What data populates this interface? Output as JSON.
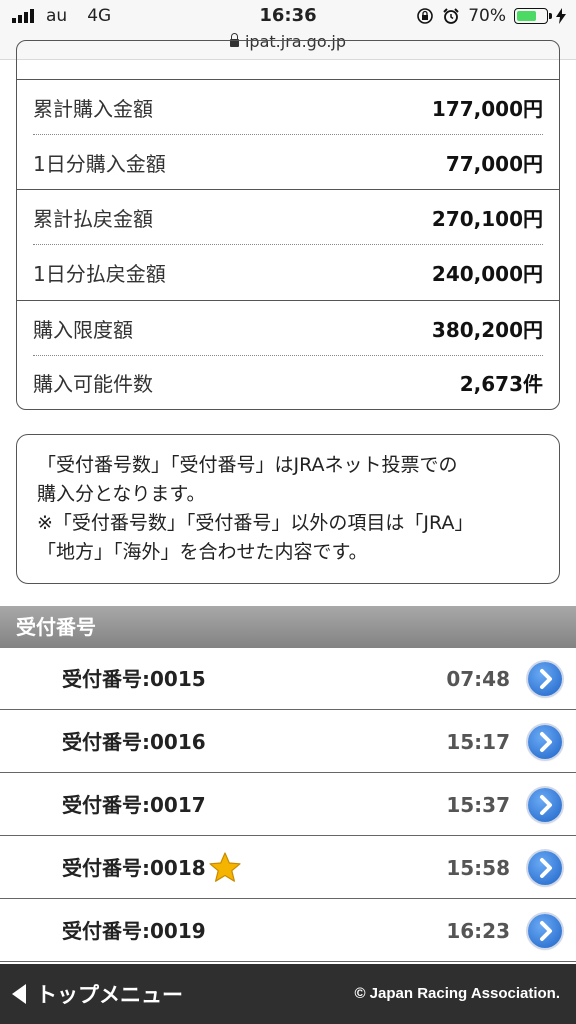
{
  "status_bar": {
    "carrier": "au",
    "network": "4G",
    "time": "16:36",
    "battery_percent": "70%",
    "battery_level": 0.7,
    "url": "ipat.jra.go.jp"
  },
  "summary": {
    "rows": [
      {
        "label": "累計購入金額",
        "value": "177,000円"
      },
      {
        "label": "1日分購入金額",
        "value": "77,000円"
      },
      {
        "label": "累計払戻金額",
        "value": "270,100円"
      },
      {
        "label": "1日分払戻金額",
        "value": "240,000円"
      },
      {
        "label": "購入限度額",
        "value": "380,200円"
      },
      {
        "label": "購入可能件数",
        "value": "2,673件"
      }
    ]
  },
  "notice": {
    "line1": "「受付番号数」「受付番号」はJRAネット投票での",
    "line2": "購入分となります。",
    "line3": "※「受付番号数」「受付番号」以外の項目は「JRA」",
    "line4": "「地方」「海外」を合わせた内容です。"
  },
  "receipts": {
    "header": "受付番号",
    "items": [
      {
        "label": "受付番号:0015",
        "time": "07:48",
        "starred": false
      },
      {
        "label": "受付番号:0016",
        "time": "15:17",
        "starred": false
      },
      {
        "label": "受付番号:0017",
        "time": "15:37",
        "starred": false
      },
      {
        "label": "受付番号:0018",
        "time": "15:58",
        "starred": true
      },
      {
        "label": "受付番号:0019",
        "time": "16:23",
        "starred": false
      }
    ]
  },
  "footer": {
    "menu_label": "トップメニュー",
    "copyright": "© Japan Racing Association."
  },
  "icons": {
    "star_color": "#f5b400",
    "arrow_color": "#2a6fd6"
  }
}
